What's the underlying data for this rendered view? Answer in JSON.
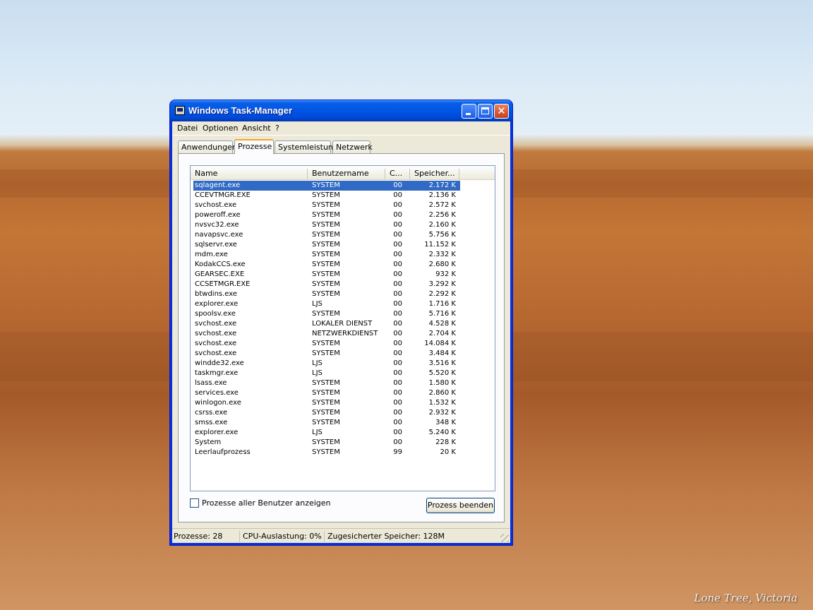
{
  "desktop": {
    "caption": "Lone Tree, Victoria"
  },
  "window": {
    "title": "Windows Task-Manager",
    "icon": "task-manager-icon",
    "controls": {
      "minimize": "minimize-icon",
      "maximize": "maximize-icon",
      "close": "close-icon"
    }
  },
  "menubar": {
    "items": [
      "Datei",
      "Optionen",
      "Ansicht",
      "?"
    ]
  },
  "tabs": {
    "items": [
      "Anwendungen",
      "Prozesse",
      "Systemleistung",
      "Netzwerk"
    ],
    "active": "Prozesse"
  },
  "process_list": {
    "columns": [
      "Name",
      "Benutzername",
      "C...",
      "Speicher..."
    ],
    "selected_row": 0,
    "rows": [
      {
        "name": "sqlagent.exe",
        "user": "SYSTEM",
        "cpu": "00",
        "mem": "2.172 K"
      },
      {
        "name": "CCEVTMGR.EXE",
        "user": "SYSTEM",
        "cpu": "00",
        "mem": "2.136 K"
      },
      {
        "name": "svchost.exe",
        "user": "SYSTEM",
        "cpu": "00",
        "mem": "2.572 K"
      },
      {
        "name": "poweroff.exe",
        "user": "SYSTEM",
        "cpu": "00",
        "mem": "2.256 K"
      },
      {
        "name": "nvsvc32.exe",
        "user": "SYSTEM",
        "cpu": "00",
        "mem": "2.160 K"
      },
      {
        "name": "navapsvc.exe",
        "user": "SYSTEM",
        "cpu": "00",
        "mem": "5.756 K"
      },
      {
        "name": "sqlservr.exe",
        "user": "SYSTEM",
        "cpu": "00",
        "mem": "11.152 K"
      },
      {
        "name": "mdm.exe",
        "user": "SYSTEM",
        "cpu": "00",
        "mem": "2.332 K"
      },
      {
        "name": "KodakCCS.exe",
        "user": "SYSTEM",
        "cpu": "00",
        "mem": "2.680 K"
      },
      {
        "name": "GEARSEC.EXE",
        "user": "SYSTEM",
        "cpu": "00",
        "mem": "932 K"
      },
      {
        "name": "CCSETMGR.EXE",
        "user": "SYSTEM",
        "cpu": "00",
        "mem": "3.292 K"
      },
      {
        "name": "btwdins.exe",
        "user": "SYSTEM",
        "cpu": "00",
        "mem": "2.292 K"
      },
      {
        "name": "explorer.exe",
        "user": "LJS",
        "cpu": "00",
        "mem": "1.716 K"
      },
      {
        "name": "spoolsv.exe",
        "user": "SYSTEM",
        "cpu": "00",
        "mem": "5.716 K"
      },
      {
        "name": "svchost.exe",
        "user": "LOKALER DIENST",
        "cpu": "00",
        "mem": "4.528 K"
      },
      {
        "name": "svchost.exe",
        "user": "NETZWERKDIENST",
        "cpu": "00",
        "mem": "2.704 K"
      },
      {
        "name": "svchost.exe",
        "user": "SYSTEM",
        "cpu": "00",
        "mem": "14.084 K"
      },
      {
        "name": "svchost.exe",
        "user": "SYSTEM",
        "cpu": "00",
        "mem": "3.484 K"
      },
      {
        "name": "windde32.exe",
        "user": "LJS",
        "cpu": "00",
        "mem": "3.516 K"
      },
      {
        "name": "taskmgr.exe",
        "user": "LJS",
        "cpu": "00",
        "mem": "5.520 K"
      },
      {
        "name": "lsass.exe",
        "user": "SYSTEM",
        "cpu": "00",
        "mem": "1.580 K"
      },
      {
        "name": "services.exe",
        "user": "SYSTEM",
        "cpu": "00",
        "mem": "2.860 K"
      },
      {
        "name": "winlogon.exe",
        "user": "SYSTEM",
        "cpu": "00",
        "mem": "1.532 K"
      },
      {
        "name": "csrss.exe",
        "user": "SYSTEM",
        "cpu": "00",
        "mem": "2.932 K"
      },
      {
        "name": "smss.exe",
        "user": "SYSTEM",
        "cpu": "00",
        "mem": "348 K"
      },
      {
        "name": "explorer.exe",
        "user": "LJS",
        "cpu": "00",
        "mem": "5.240 K"
      },
      {
        "name": "System",
        "user": "SYSTEM",
        "cpu": "00",
        "mem": "228 K"
      },
      {
        "name": "Leerlaufprozess",
        "user": "SYSTEM",
        "cpu": "99",
        "mem": "20 K"
      }
    ]
  },
  "options": {
    "show_all_users_label": "Prozesse aller Benutzer anzeigen",
    "show_all_users_checked": false
  },
  "buttons": {
    "end_process": "Prozess beenden"
  },
  "statusbar": {
    "processes": "Prozesse: 28",
    "cpu": "CPU-Auslastung: 0%",
    "memory": "Zugesicherter Speicher: 128M"
  }
}
